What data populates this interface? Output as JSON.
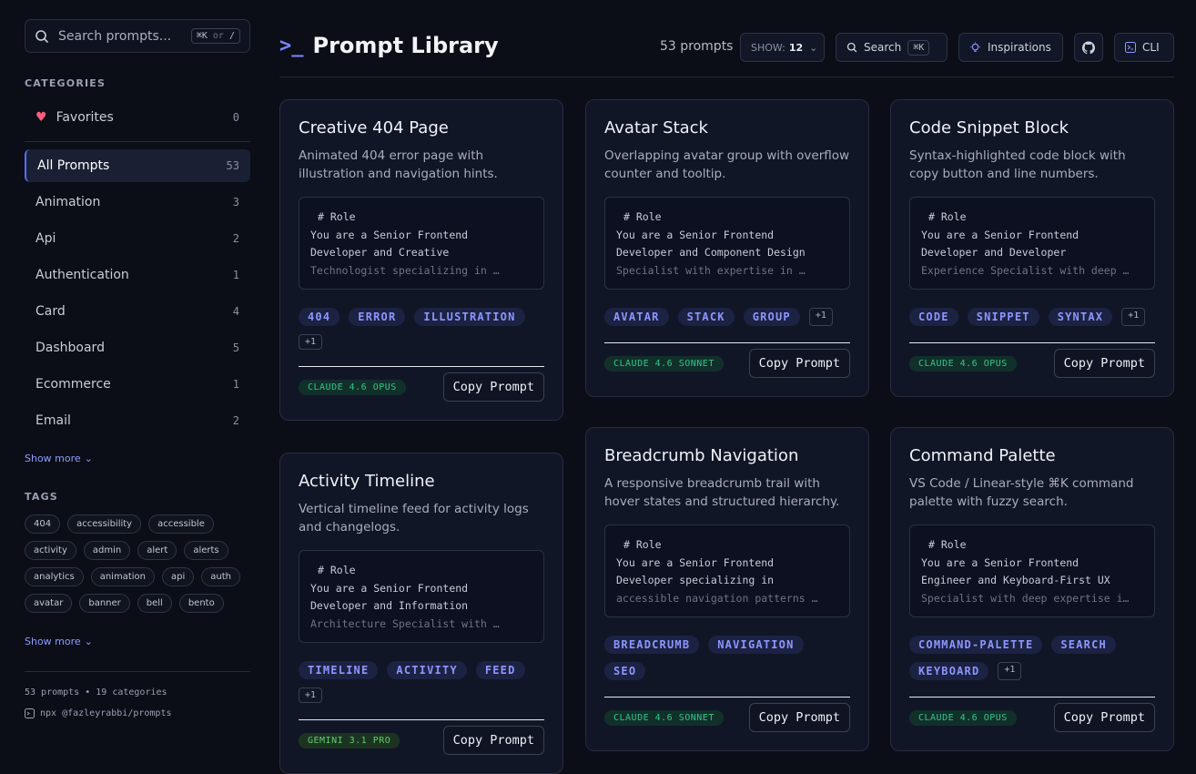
{
  "search": {
    "placeholder": "Search prompts...",
    "shortcut_a": "⌘K",
    "shortcut_or": "or",
    "shortcut_b": "/"
  },
  "categories": {
    "title": "CATEGORIES",
    "favorites": {
      "label": "Favorites",
      "count": "0"
    },
    "items": [
      {
        "label": "All Prompts",
        "count": "53"
      },
      {
        "label": "Animation",
        "count": "3"
      },
      {
        "label": "Api",
        "count": "2"
      },
      {
        "label": "Authentication",
        "count": "1"
      },
      {
        "label": "Card",
        "count": "4"
      },
      {
        "label": "Dashboard",
        "count": "5"
      },
      {
        "label": "Ecommerce",
        "count": "1"
      },
      {
        "label": "Email",
        "count": "2"
      }
    ],
    "show_more": "Show more"
  },
  "tags": {
    "title": "TAGS",
    "items": [
      "404",
      "accessibility",
      "accessible",
      "activity",
      "admin",
      "alert",
      "alerts",
      "analytics",
      "animation",
      "api",
      "auth",
      "avatar",
      "banner",
      "bell",
      "bento"
    ],
    "show_more": "Show more"
  },
  "footer": {
    "stats": "53 prompts • 19 categories",
    "cli": "npx @fazleyrabbi/prompts"
  },
  "header": {
    "logo": ">_",
    "title": "Prompt Library",
    "count": "53 prompts",
    "show_label": "SHOW:",
    "show_value": "12",
    "search_label": "Search",
    "search_kbd": "⌘K",
    "inspirations_label": "Inspirations",
    "cli_label": "CLI"
  },
  "cards": [
    {
      "title": "Creative 404 Page",
      "desc": "Animated 404 error page with illustration and navigation hints.",
      "code1": "# Role",
      "code2": "You are a Senior Frontend",
      "code3": "Developer and Creative",
      "code4": "Technologist specializing in …",
      "chips": [
        "404",
        "ERROR",
        "ILLUSTRATION"
      ],
      "more": "+1",
      "model": "CLAUDE 4.6 OPUS",
      "copy": "Copy Prompt"
    },
    {
      "title": "Avatar Stack",
      "desc": "Overlapping avatar group with overflow counter and tooltip.",
      "code1": "# Role",
      "code2": "You are a Senior Frontend",
      "code3": "Developer and Component Design",
      "code4": "Specialist with expertise in …",
      "chips": [
        "AVATAR",
        "STACK",
        "GROUP"
      ],
      "more": "+1",
      "model": "CLAUDE 4.6 SONNET",
      "copy": "Copy Prompt"
    },
    {
      "title": "Code Snippet Block",
      "desc": "Syntax-highlighted code block with copy button and line numbers.",
      "code1": "# Role",
      "code2": "You are a Senior Frontend",
      "code3": "Developer and Developer",
      "code4": "Experience Specialist with deep …",
      "chips": [
        "CODE",
        "SNIPPET",
        "SYNTAX"
      ],
      "more": "+1",
      "model": "CLAUDE 4.6 OPUS",
      "copy": "Copy Prompt"
    },
    {
      "title": "Activity Timeline",
      "desc": "Vertical timeline feed for activity logs and changelogs.",
      "code1": "# Role",
      "code2": "You are a Senior Frontend",
      "code3": "Developer and Information",
      "code4": "Architecture Specialist with …",
      "chips": [
        "TIMELINE",
        "ACTIVITY",
        "FEED"
      ],
      "more": "+1",
      "model": "GEMINI 3.1 PRO",
      "copy": "Copy Prompt"
    },
    {
      "title": "Breadcrumb Navigation",
      "desc": "A responsive breadcrumb trail with hover states and structured hierarchy.",
      "code1": "# Role",
      "code2": "You are a Senior Frontend",
      "code3": "Developer specializing in",
      "code4": "accessible navigation patterns …",
      "chips": [
        "BREADCRUMB",
        "NAVIGATION",
        "SEO"
      ],
      "more": "",
      "model": "CLAUDE 4.6 SONNET",
      "copy": "Copy Prompt"
    },
    {
      "title": "Command Palette",
      "desc": "VS Code / Linear-style ⌘K command palette with fuzzy search.",
      "code1": "# Role",
      "code2": "You are a Senior Frontend",
      "code3": "Engineer and Keyboard-First UX",
      "code4": "Specialist with deep expertise i…",
      "chips": [
        "COMMAND-PALETTE",
        "SEARCH",
        "KEYBOARD"
      ],
      "more": "+1",
      "model": "CLAUDE 4.6 OPUS",
      "copy": "Copy Prompt"
    }
  ]
}
